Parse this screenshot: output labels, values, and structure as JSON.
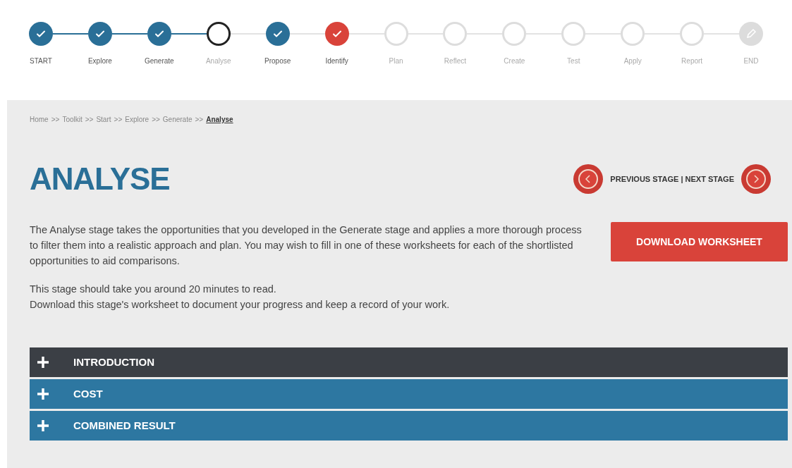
{
  "stepper": [
    {
      "label": "START",
      "kind": "done"
    },
    {
      "label": "Explore",
      "kind": "done"
    },
    {
      "label": "Generate",
      "kind": "done"
    },
    {
      "label": "Analyse",
      "kind": "current"
    },
    {
      "label": "Propose",
      "kind": "done"
    },
    {
      "label": "Identify",
      "kind": "flagged"
    },
    {
      "label": "Plan",
      "kind": "pending"
    },
    {
      "label": "Reflect",
      "kind": "pending"
    },
    {
      "label": "Create",
      "kind": "pending"
    },
    {
      "label": "Test",
      "kind": "pending"
    },
    {
      "label": "Apply",
      "kind": "pending"
    },
    {
      "label": "Report",
      "kind": "pending"
    },
    {
      "label": "END",
      "kind": "end"
    }
  ],
  "breadcrumb": [
    {
      "label": "Home",
      "current": false
    },
    {
      "label": "Toolkit",
      "current": false
    },
    {
      "label": "Start",
      "current": false
    },
    {
      "label": "Explore",
      "current": false
    },
    {
      "label": "Generate",
      "current": false
    },
    {
      "label": "Analyse",
      "current": true
    }
  ],
  "breadcrumb_separator": ">>",
  "title": "ANALYSE",
  "stage_nav": "PREVIOUS STAGE | NEXT STAGE",
  "intro": "The Analyse stage takes the opportunities that you developed in the Generate stage and applies a more thorough process to filter them into a realistic approach and plan. You may wish to fill in one of these worksheets for each of the shortlisted opportunities to aid comparisons.",
  "notes": [
    "This stage should take you around 20 minutes to read.",
    "Download this stage's worksheet to document your progress and keep a record of your work."
  ],
  "download_button": "DOWNLOAD WORKSHEET",
  "sections": [
    {
      "label": "INTRODUCTION",
      "kind": "dark"
    },
    {
      "label": "COST",
      "kind": "blue"
    },
    {
      "label": "COMBINED RESULT",
      "kind": "blue"
    }
  ]
}
